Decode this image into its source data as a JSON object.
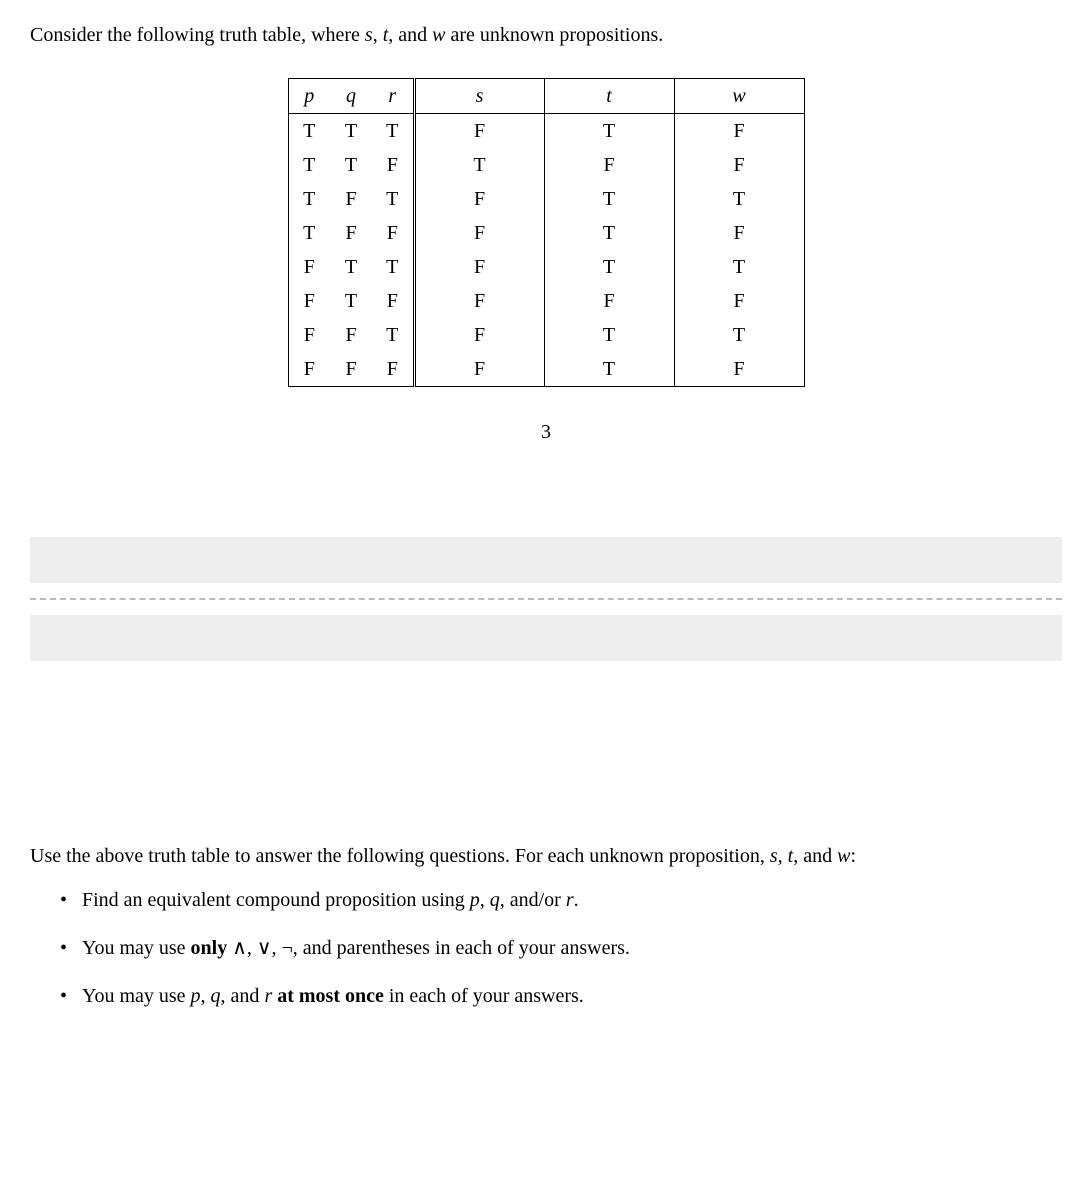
{
  "intro_parts": {
    "p1": "Consider the following truth table, where ",
    "v1": "s",
    "p2": ", ",
    "v2": "t",
    "p3": ", and ",
    "v3": "w",
    "p4": " are unknown propositions."
  },
  "table": {
    "headers": [
      "p",
      "q",
      "r",
      "s",
      "t",
      "w"
    ],
    "rows": [
      [
        "T",
        "T",
        "T",
        "F",
        "T",
        "F"
      ],
      [
        "T",
        "T",
        "F",
        "T",
        "F",
        "F"
      ],
      [
        "T",
        "F",
        "T",
        "F",
        "T",
        "T"
      ],
      [
        "T",
        "F",
        "F",
        "F",
        "T",
        "F"
      ],
      [
        "F",
        "T",
        "T",
        "F",
        "T",
        "T"
      ],
      [
        "F",
        "T",
        "F",
        "F",
        "F",
        "F"
      ],
      [
        "F",
        "F",
        "T",
        "F",
        "T",
        "T"
      ],
      [
        "F",
        "F",
        "F",
        "F",
        "T",
        "F"
      ]
    ]
  },
  "page_number": "3",
  "instructions_parts": {
    "p1": "Use the above truth table to answer the following questions. For each unknown proposition, ",
    "v1": "s",
    "p2": ", ",
    "v2": "t",
    "p3": ", and ",
    "v3": "w",
    "p4": ":"
  },
  "bullets": [
    {
      "p1": "Find an equivalent compound proposition using ",
      "v1": "p",
      "p2": ", ",
      "v2": "q",
      "p3": ", and/or ",
      "v3": "r",
      "p4": "."
    },
    {
      "p1": "You may use ",
      "bold": "only",
      "p2": " ∧, ∨, ¬, and parentheses in each of your answers."
    },
    {
      "p1": "You may use ",
      "v1": "p",
      "p2": ", ",
      "v2": "q",
      "p3": ", and ",
      "v3": "r",
      "p4": " ",
      "bold": "at most once",
      "p5": " in each of your answers."
    }
  ]
}
